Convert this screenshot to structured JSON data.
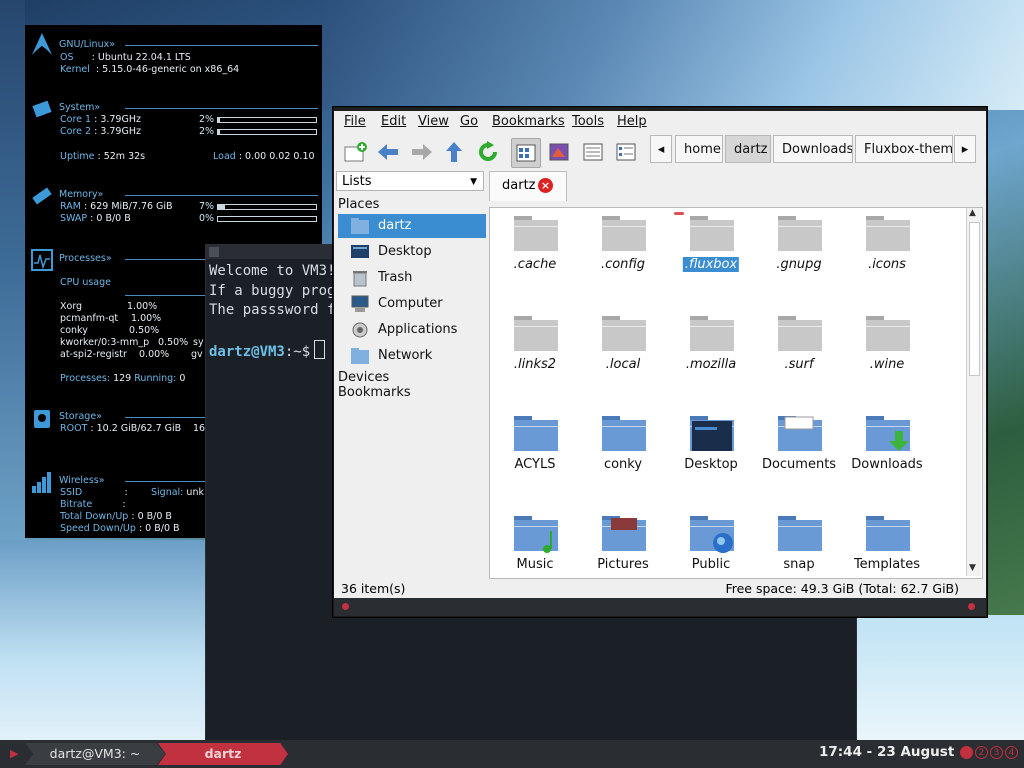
{
  "conky": {
    "system_header": "GNU/Linux»",
    "os_label": "OS",
    "os_value": ": Ubuntu 22.04.1 LTS",
    "kernel_label": "Kernel",
    "kernel_value": ": 5.15.0-46-generic on x86_64",
    "cpu_header": "System»",
    "core1_label": "Core 1",
    "core1_value": ": 3.79GHz",
    "core1_pct": "2%",
    "core1_fill": 0.02,
    "core2_label": "Core 2",
    "core2_value": ": 3.79GHz",
    "core2_pct": "2%",
    "core2_fill": 0.02,
    "uptime_label": "Uptime",
    "uptime_value": ": 52m 32s",
    "load_label": "Load",
    "load_value": ": 0.00 0.02 0.10",
    "memory_header": "Memory»",
    "ram_label": "RAM",
    "ram_value": ": 629 MiB/7.76 GiB",
    "ram_pct": "7%",
    "ram_fill": 0.07,
    "swap_label": "SWAP",
    "swap_value": ": 0 B/0 B",
    "swap_pct": "0%",
    "processes_header": "Processes»",
    "cpu_usage_label": "CPU usage",
    "procs": [
      {
        "name": "Xorg",
        "pct": "1.00%"
      },
      {
        "name": "pcmanfm-qt",
        "pct": "1.00%"
      },
      {
        "name": "conky",
        "pct": "0.50%"
      },
      {
        "name": "kworker/0:3-mm_p",
        "pct": "0.50%",
        "extra": "sy"
      },
      {
        "name": "at-spi2-registr",
        "pct": "0.00%",
        "extra": "gv"
      }
    ],
    "processes_label": "Processes:",
    "processes_value": "129",
    "running_label": "Running:",
    "running_value": "0",
    "storage_header": "Storage»",
    "root_label": "ROOT",
    "root_value": ": 10.2 GiB/62.7 GiB",
    "root_extra": "16",
    "wireless_header": "Wireless»",
    "ssid_label": "SSID",
    "ssid_value": ":",
    "signal_label": "Signal:",
    "signal_value": "unk",
    "bitrate_label": "Bitrate",
    "bitrate_value": ":",
    "total_label": "Total Down/Up",
    "total_value": ": 0 B/0 B",
    "speed_label": "Speed Down/Up",
    "speed_value": ": 0 B/0 B"
  },
  "terminal": {
    "line1": "Welcome to VM3!",
    "line2": "If a buggy prog",
    "line3": "The passsword fo",
    "prompt_user": "dartz@VM3",
    "prompt_rest": ":~$"
  },
  "filemanager": {
    "menu": [
      "File",
      "Edit",
      "View",
      "Go",
      "Bookmarks",
      "Tools",
      "Help"
    ],
    "breadcrumbs": [
      "home",
      "dartz",
      "Downloads",
      "Fluxbox-theme"
    ],
    "lists_label": "Lists",
    "places_label": "Places",
    "places": [
      "dartz",
      "Desktop",
      "Trash",
      "Computer",
      "Applications",
      "Network"
    ],
    "devices_label": "Devices",
    "bookmarks_label": "Bookmarks",
    "tab_label": "dartz",
    "items": [
      ".cache",
      ".config",
      ".fluxbox",
      ".gnupg",
      ".icons",
      ".links2",
      ".local",
      ".mozilla",
      ".surf",
      ".wine",
      "ACYLS",
      "conky",
      "Desktop",
      "Documents",
      "Downloads",
      "Music",
      "Pictures",
      "Public",
      "snap",
      "Templates"
    ],
    "status_left": "36 item(s)",
    "status_right": "Free space: 49.3 GiB (Total: 62.7 GiB)"
  },
  "taskbar": {
    "task1": "dartz@VM3: ~",
    "task2": "dartz",
    "clock": "17:44 - 23 August",
    "workspaces": [
      "1",
      "2",
      "3",
      "4"
    ]
  },
  "colors": {
    "accent": "#c23140",
    "select": "#3a8dd0",
    "conky_label": "#6fb6e6"
  }
}
